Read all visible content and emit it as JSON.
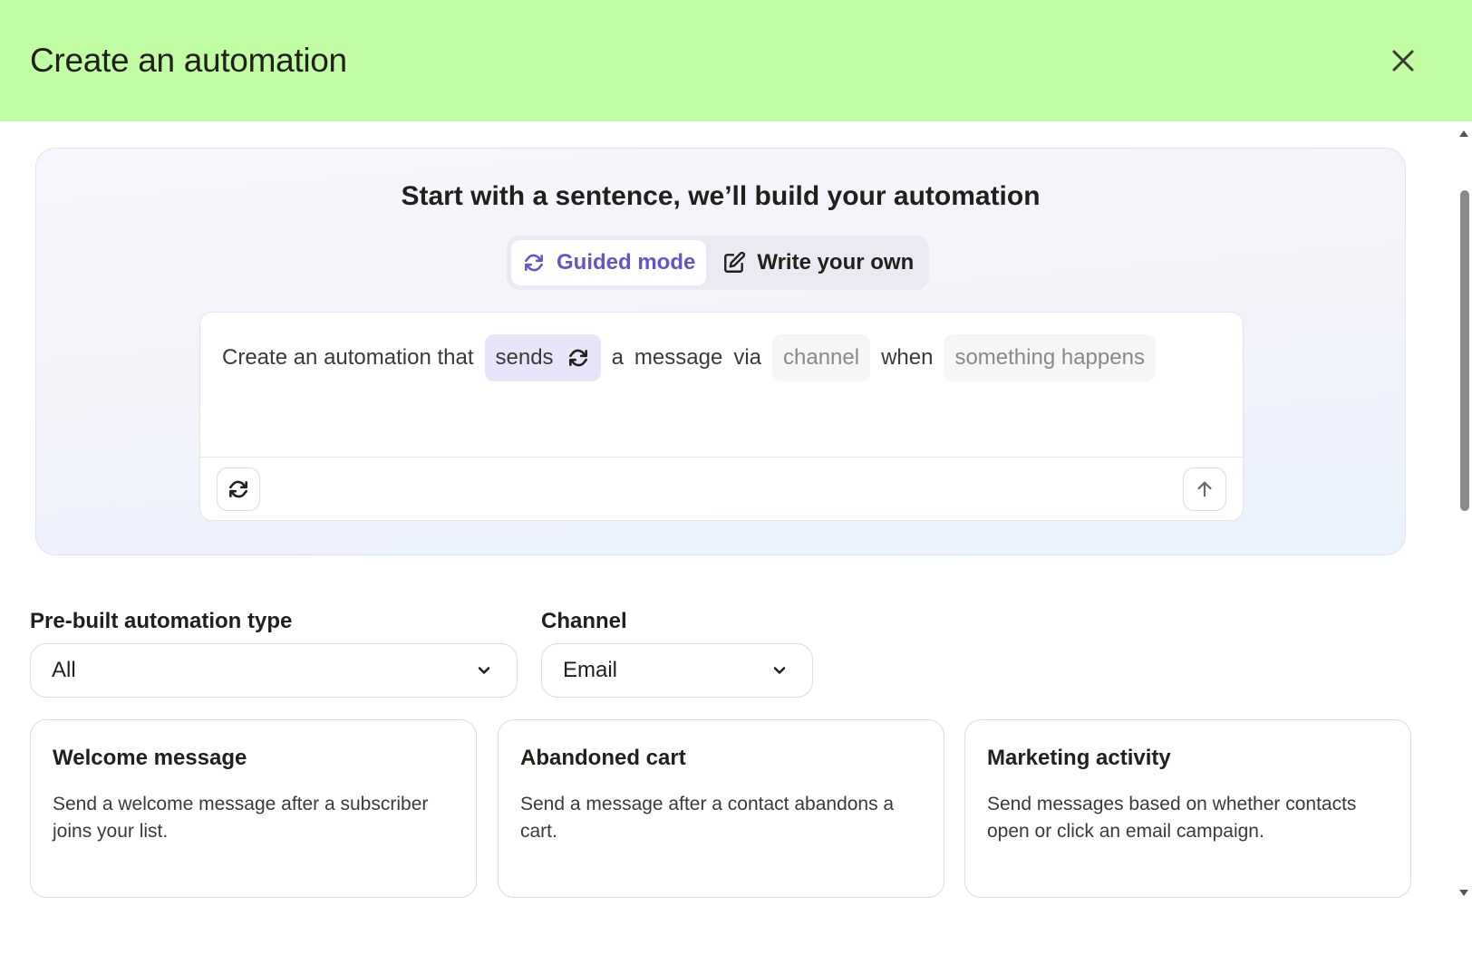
{
  "header": {
    "title": "Create an automation",
    "background": "#c1fea3"
  },
  "hero": {
    "title": "Start with a sentence, we’ll build your automation",
    "modes": {
      "guided": "Guided mode",
      "write": "Write your own"
    },
    "sentence": {
      "prefix": "Create an automation that",
      "verb": "sends",
      "word_a": "a",
      "word_message": "message",
      "word_via": "via",
      "channel_placeholder": "channel",
      "word_when": "when",
      "trigger_placeholder": "something happens"
    }
  },
  "filters": {
    "type_label": "Pre-built automation type",
    "type_value": "All",
    "channel_label": "Channel",
    "channel_value": "Email"
  },
  "cards": [
    {
      "title": "Welcome message",
      "description": "Send a welcome message after a subscriber joins your list."
    },
    {
      "title": "Abandoned cart",
      "description": "Send a message after a contact abandons a cart."
    },
    {
      "title": "Marketing activity",
      "description": "Send messages based on whether contacts open or click an email campaign."
    }
  ],
  "colors": {
    "accent": "#6a52c9",
    "chip_selected": "#e8e5fa"
  },
  "icons": [
    "close-icon",
    "refresh-icon",
    "edit-icon",
    "arrow-up-icon",
    "chevron-down-icon"
  ]
}
